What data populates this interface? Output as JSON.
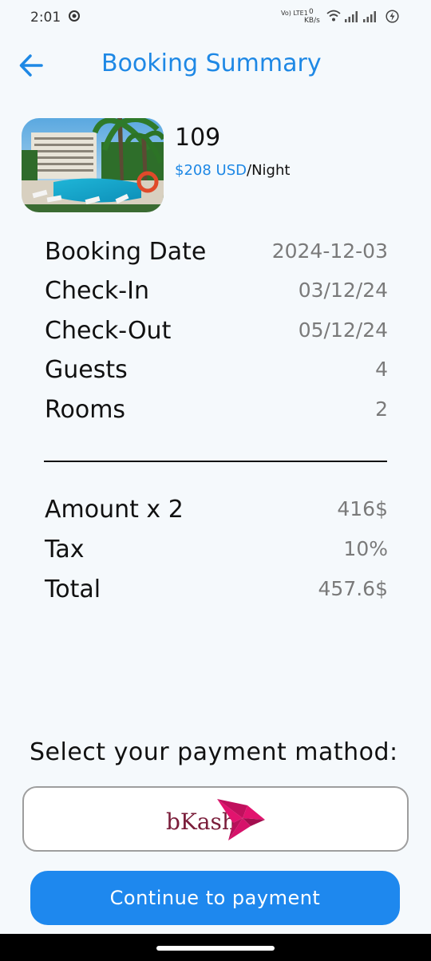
{
  "status_bar": {
    "time": "2:01",
    "network_label": "Vo) LTE1",
    "speed_value": "0",
    "speed_unit": "KB/s"
  },
  "header": {
    "title": "Booking Summary"
  },
  "hotel": {
    "name": "109",
    "price": "$208 USD",
    "price_unit": "/Night"
  },
  "details": [
    {
      "label": "Booking Date",
      "value": "2024-12-03"
    },
    {
      "label": "Check-In",
      "value": "03/12/24"
    },
    {
      "label": "Check-Out",
      "value": "05/12/24"
    },
    {
      "label": "Guests",
      "value": "4"
    },
    {
      "label": "Rooms",
      "value": "2"
    }
  ],
  "totals": [
    {
      "label": "Amount x 2",
      "value": "416$"
    },
    {
      "label": "Tax",
      "value": "10%"
    },
    {
      "label": "Total",
      "value": "457.6$"
    }
  ],
  "payment": {
    "heading": "Select your payment mathod:",
    "option_label": "bKash",
    "continue_label": "Continue to payment"
  },
  "colors": {
    "accent": "#1e88e5",
    "bkash_pink": "#e2136e",
    "background": "#f5f9fc"
  }
}
